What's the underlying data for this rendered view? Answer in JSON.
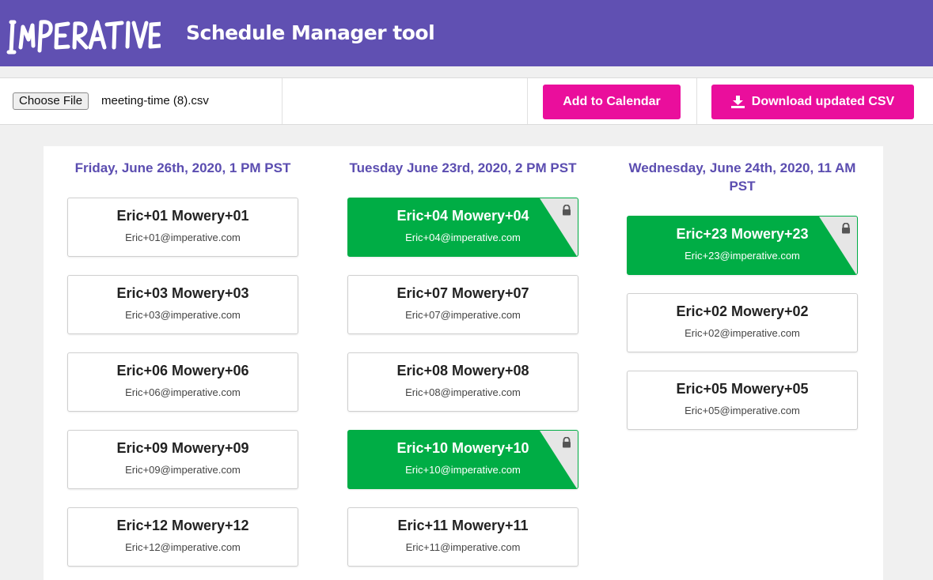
{
  "header": {
    "logo_text": "IMPERATIVE",
    "title": "Schedule Manager tool",
    "background": "#6050b2"
  },
  "toolbar": {
    "file_button_label": "Choose File",
    "file_name": "meeting-time (8).csv",
    "add_to_calendar_label": "Add to Calendar",
    "download_label": "Download updated CSV",
    "download_icon": "download-icon",
    "button_color": "#ea0e9c"
  },
  "columns": [
    {
      "title": "Friday, June 26th, 2020, 1 PM PST",
      "cards": [
        {
          "name": "Eric+01 Mowery+01",
          "email": "Eric+01@imperative.com",
          "locked": false
        },
        {
          "name": "Eric+03 Mowery+03",
          "email": "Eric+03@imperative.com",
          "locked": false
        },
        {
          "name": "Eric+06 Mowery+06",
          "email": "Eric+06@imperative.com",
          "locked": false
        },
        {
          "name": "Eric+09 Mowery+09",
          "email": "Eric+09@imperative.com",
          "locked": false
        },
        {
          "name": "Eric+12 Mowery+12",
          "email": "Eric+12@imperative.com",
          "locked": false
        }
      ]
    },
    {
      "title": "Tuesday June 23rd, 2020, 2 PM PST",
      "cards": [
        {
          "name": "Eric+04 Mowery+04",
          "email": "Eric+04@imperative.com",
          "locked": true
        },
        {
          "name": "Eric+07 Mowery+07",
          "email": "Eric+07@imperative.com",
          "locked": false
        },
        {
          "name": "Eric+08 Mowery+08",
          "email": "Eric+08@imperative.com",
          "locked": false
        },
        {
          "name": "Eric+10 Mowery+10",
          "email": "Eric+10@imperative.com",
          "locked": true
        },
        {
          "name": "Eric+11 Mowery+11",
          "email": "Eric+11@imperative.com",
          "locked": false
        }
      ]
    },
    {
      "title": "Wednesday, June 24th, 2020, 11 AM PST",
      "cards": [
        {
          "name": "Eric+23 Mowery+23",
          "email": "Eric+23@imperative.com",
          "locked": true
        },
        {
          "name": "Eric+02 Mowery+02",
          "email": "Eric+02@imperative.com",
          "locked": false
        },
        {
          "name": "Eric+05 Mowery+05",
          "email": "Eric+05@imperative.com",
          "locked": false
        }
      ]
    }
  ],
  "colors": {
    "locked_card": "#00ad45",
    "column_title": "#5b4db0",
    "lock_icon": "lock-icon"
  }
}
